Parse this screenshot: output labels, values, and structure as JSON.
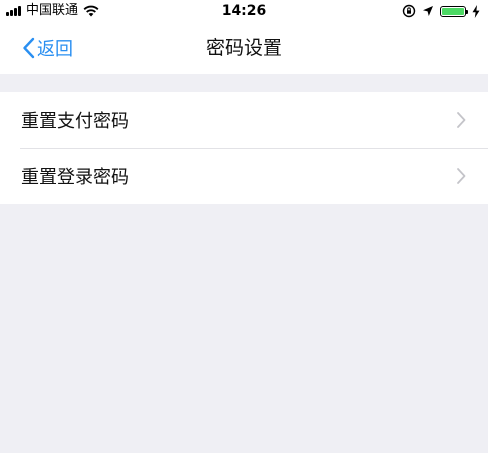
{
  "status_bar": {
    "carrier": "中国联通",
    "time": "14:26",
    "battery_level": 1.0,
    "battery_color": "#4cd964"
  },
  "nav": {
    "back_label": "返回",
    "title": "密码设置",
    "accent_color": "#2a8ff1"
  },
  "settings": {
    "items": [
      {
        "label": "重置支付密码",
        "icon": "chevron-right-icon"
      },
      {
        "label": "重置登录密码",
        "icon": "chevron-right-icon"
      }
    ]
  },
  "icons": {
    "signal": "signal-icon",
    "wifi": "wifi-icon",
    "lock_rotation": "orientation-lock-icon",
    "location": "location-icon",
    "battery": "battery-icon",
    "charging": "charging-icon",
    "back": "chevron-left-icon"
  }
}
